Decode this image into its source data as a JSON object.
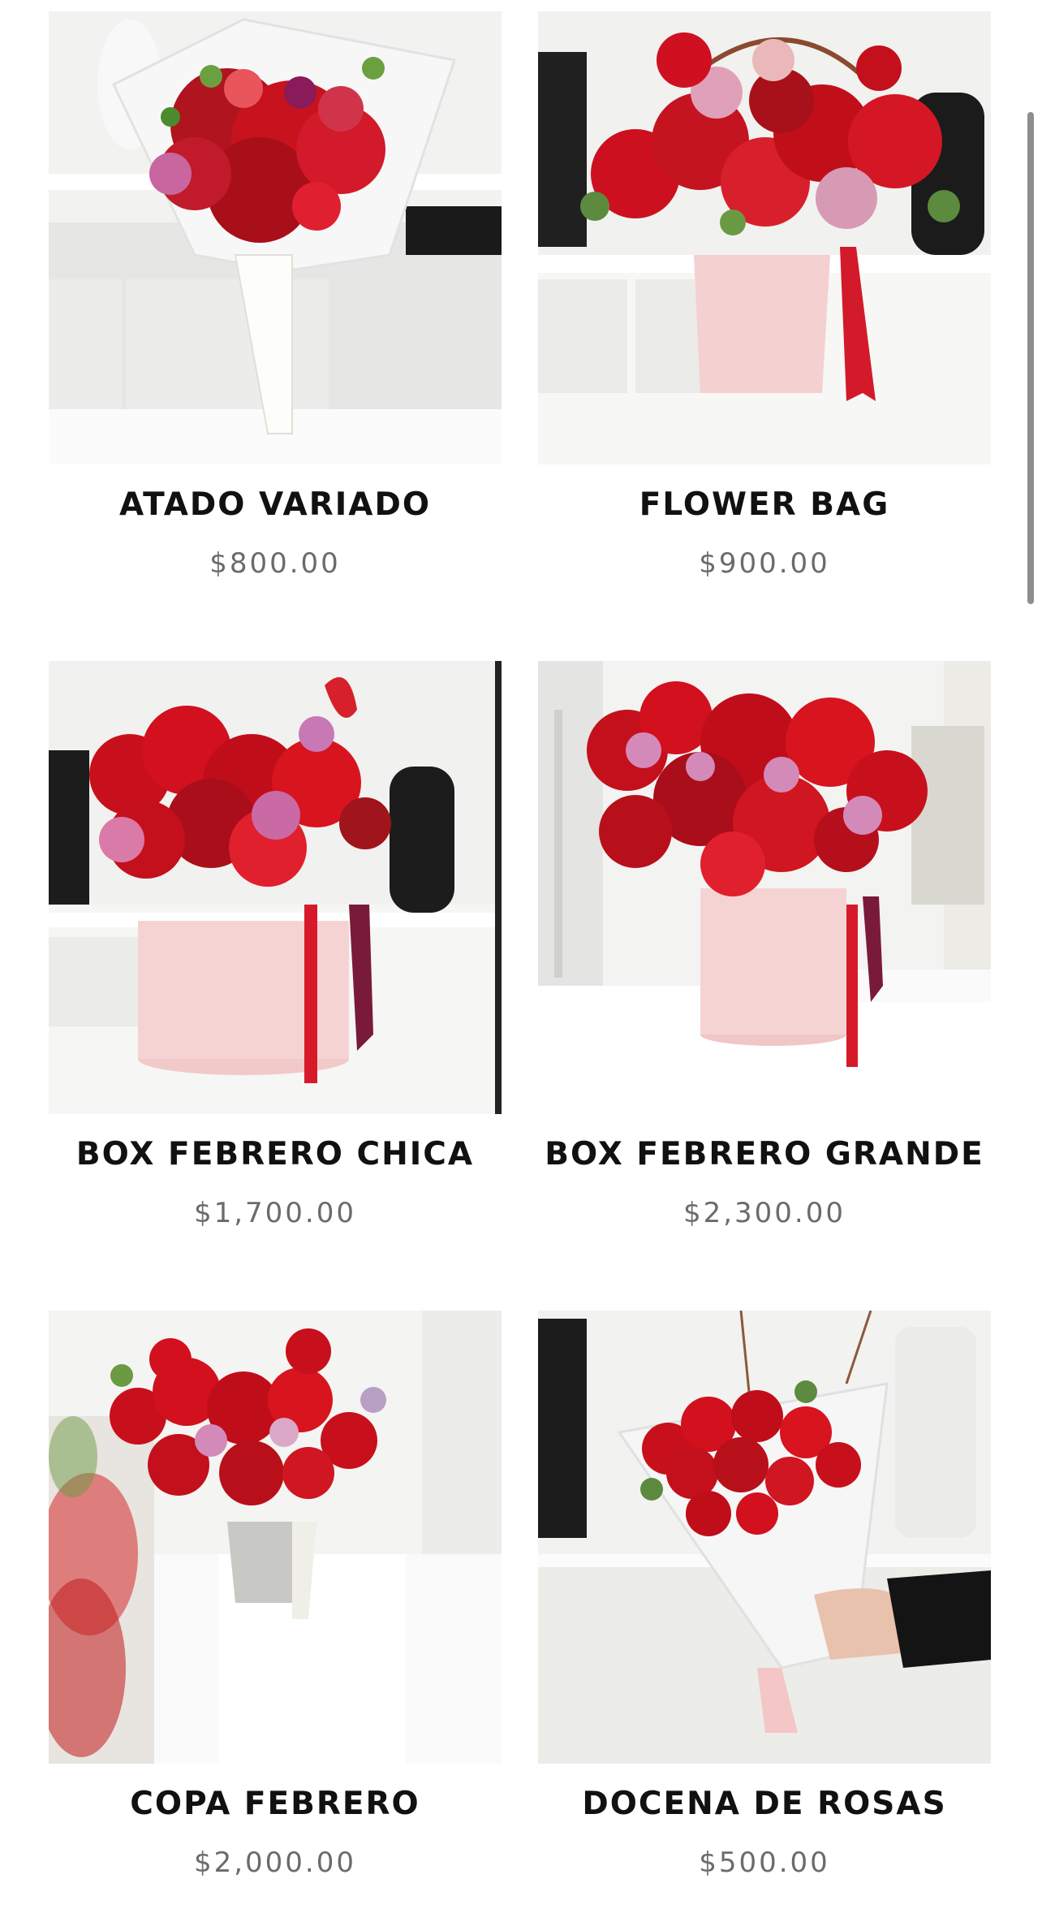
{
  "products": [
    {
      "name": "ATADO VARIADO",
      "price": "$800.00",
      "image": "bouquet-wrapped-mixed"
    },
    {
      "name": "FLOWER BAG",
      "price": "$900.00",
      "image": "pink-bag-arrangement"
    },
    {
      "name": "BOX FEBRERO CHICA",
      "price": "$1,700.00",
      "image": "pink-hatbox-small"
    },
    {
      "name": "BOX FEBRERO GRANDE",
      "price": "$2,300.00",
      "image": "pink-hatbox-large"
    },
    {
      "name": "COPA FEBRERO",
      "price": "$2,000.00",
      "image": "grey-vase-arrangement"
    },
    {
      "name": "DOCENA DE ROSAS",
      "price": "$500.00",
      "image": "dozen-roses-wrapped"
    }
  ],
  "colors": {
    "title": "#111111",
    "price": "#6b6b6b",
    "rose_red": "#d0101c",
    "box_pink": "#f6d6d6"
  }
}
